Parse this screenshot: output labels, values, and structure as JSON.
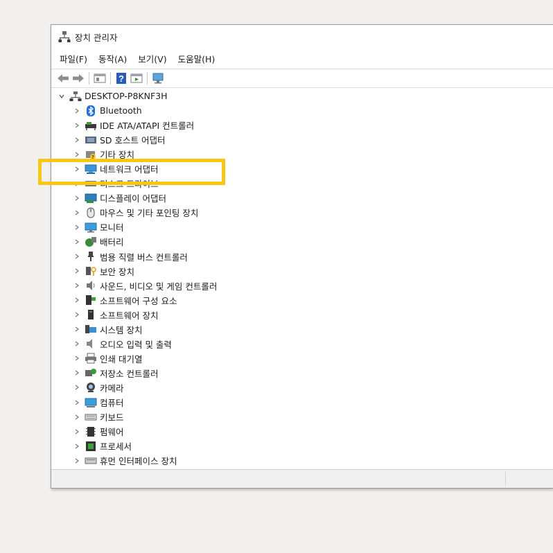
{
  "window": {
    "title": "장치 관리자"
  },
  "menu": [
    "파일(F)",
    "동작(A)",
    "보기(V)",
    "도움말(H)"
  ],
  "toolbar": {
    "buttons": [
      "back-icon",
      "forward-icon",
      "properties-icon",
      "help-icon",
      "run-icon",
      "monitor-icon"
    ]
  },
  "tree": {
    "root": "DESKTOP-P8KNF3H",
    "items": [
      {
        "label": "Bluetooth",
        "icon": "bluetooth-icon"
      },
      {
        "label": "IDE ATA/ATAPI 컨트롤러",
        "icon": "ide-controller-icon"
      },
      {
        "label": "SD 호스트 어댑터",
        "icon": "sd-host-icon"
      },
      {
        "label": "기타 장치",
        "icon": "other-device-icon"
      },
      {
        "label": "네트워크 어댑터",
        "icon": "network-adapter-icon"
      },
      {
        "label": "디스크 드라이브",
        "icon": "disk-drive-icon"
      },
      {
        "label": "디스플레이 어댑터",
        "icon": "display-adapter-icon"
      },
      {
        "label": "마우스 및 기타 포인팅 장치",
        "icon": "mouse-icon"
      },
      {
        "label": "모니터",
        "icon": "monitor-icon"
      },
      {
        "label": "배터리",
        "icon": "battery-icon"
      },
      {
        "label": "범용 직렬 버스 컨트롤러",
        "icon": "usb-icon"
      },
      {
        "label": "보안 장치",
        "icon": "security-device-icon"
      },
      {
        "label": "사운드, 비디오 및 게임 컨트롤러",
        "icon": "sound-icon"
      },
      {
        "label": "소프트웨어 구성 요소",
        "icon": "software-component-icon"
      },
      {
        "label": "소프트웨어 장치",
        "icon": "software-device-icon"
      },
      {
        "label": "시스템 장치",
        "icon": "system-device-icon"
      },
      {
        "label": "오디오 입력 및 출력",
        "icon": "audio-io-icon"
      },
      {
        "label": "인쇄 대기열",
        "icon": "print-queue-icon"
      },
      {
        "label": "저장소 컨트롤러",
        "icon": "storage-controller-icon"
      },
      {
        "label": "카메라",
        "icon": "camera-icon"
      },
      {
        "label": "컴퓨터",
        "icon": "computer-icon"
      },
      {
        "label": "키보드",
        "icon": "keyboard-icon"
      },
      {
        "label": "펌웨어",
        "icon": "firmware-icon"
      },
      {
        "label": "프로세서",
        "icon": "processor-icon"
      },
      {
        "label": "휴먼 인터페이스 장치",
        "icon": "hid-icon"
      }
    ]
  },
  "colors": {
    "highlight": "#f7c716",
    "accent": "#2f7fd3"
  }
}
